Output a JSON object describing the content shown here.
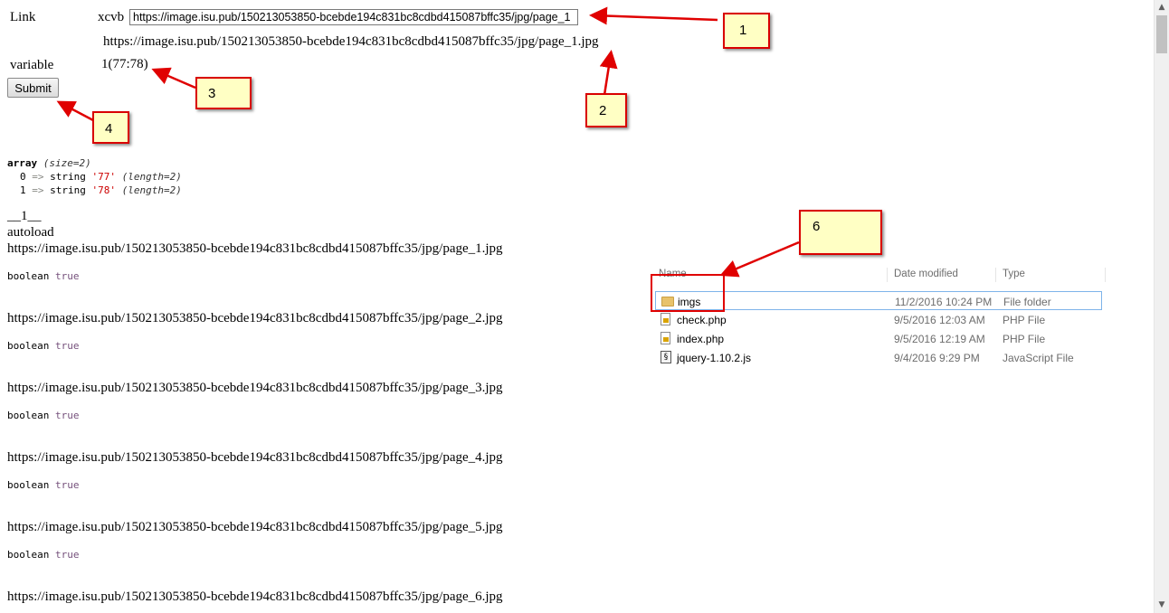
{
  "form": {
    "link_label": "Link",
    "prefix_text": "xcvb",
    "link_value": "https://image.isu.pub/150213053850-bcebde194c831bc8cdbd415087bffc35/jpg/page_1",
    "echo_url": "https://image.isu.pub/150213053850-bcebde194c831bc8cdbd415087bffc35/jpg/page_1.jpg",
    "variable_label": "variable",
    "variable_value": "1(77:78)",
    "submit_label": "Submit"
  },
  "dump": {
    "line1_kw": "array",
    "line1_meta": "(size=2)",
    "items": [
      {
        "index": "0",
        "arrow": "=>",
        "type": "string",
        "value": "'77'",
        "meta": "(length=2)"
      },
      {
        "index": "1",
        "arrow": "=>",
        "type": "string",
        "value": "'78'",
        "meta": "(length=2)"
      }
    ]
  },
  "output": {
    "marker": "__1__",
    "autoload": "autoload",
    "entries": [
      {
        "url": "https://image.isu.pub/150213053850-bcebde194c831bc8cdbd415087bffc35/jpg/page_1.jpg",
        "bool_type": "boolean",
        "bool_value": "true"
      },
      {
        "url": "https://image.isu.pub/150213053850-bcebde194c831bc8cdbd415087bffc35/jpg/page_2.jpg",
        "bool_type": "boolean",
        "bool_value": "true"
      },
      {
        "url": "https://image.isu.pub/150213053850-bcebde194c831bc8cdbd415087bffc35/jpg/page_3.jpg",
        "bool_type": "boolean",
        "bool_value": "true"
      },
      {
        "url": "https://image.isu.pub/150213053850-bcebde194c831bc8cdbd415087bffc35/jpg/page_4.jpg",
        "bool_type": "boolean",
        "bool_value": "true"
      },
      {
        "url": "https://image.isu.pub/150213053850-bcebde194c831bc8cdbd415087bffc35/jpg/page_5.jpg",
        "bool_type": "boolean",
        "bool_value": "true"
      },
      {
        "url": "https://image.isu.pub/150213053850-bcebde194c831bc8cdbd415087bffc35/jpg/page_6.jpg"
      }
    ]
  },
  "explorer": {
    "columns": [
      "Name",
      "Date modified",
      "Type"
    ],
    "files": [
      {
        "name": "imgs",
        "date": "11/2/2016 10:24 PM",
        "type": "File folder",
        "icon": "folder-icon"
      },
      {
        "name": "check.php",
        "date": "9/5/2016 12:03 AM",
        "type": "PHP File",
        "icon": "php-file-icon"
      },
      {
        "name": "index.php",
        "date": "9/5/2016 12:19 AM",
        "type": "PHP File",
        "icon": "php-file-icon"
      },
      {
        "name": "jquery-1.10.2.js",
        "date": "9/4/2016 9:29 PM",
        "type": "JavaScript File",
        "icon": "js-file-icon"
      }
    ]
  },
  "annotations": [
    "1",
    "2",
    "3",
    "4",
    "6"
  ],
  "colors": {
    "callout_fill": "#ffffc4",
    "callout_border": "#d90000",
    "arrow": "#e00000",
    "dump_string": "#cc0000",
    "dump_bool": "#75507b"
  },
  "scrollbar": {
    "up_icon": "scroll-up-arrow-icon",
    "down_icon": "scroll-down-arrow-icon"
  }
}
